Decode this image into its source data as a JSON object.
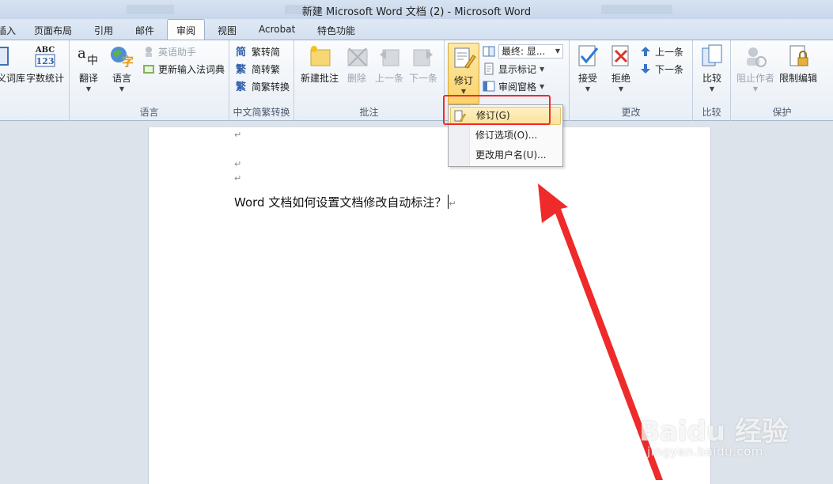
{
  "window": {
    "title": "新建 Microsoft Word 文档 (2)  -  Microsoft Word"
  },
  "tabs": [
    "插入",
    "页面布局",
    "引用",
    "邮件",
    "审阅",
    "视图",
    "Acrobat",
    "特色功能"
  ],
  "active_tab": "审阅",
  "ribbon": {
    "proofing": {
      "thesaurus_label": "义词库",
      "wordcount_label": "字数统计"
    },
    "language": {
      "group_label": "语言",
      "translate_label": "翻译",
      "language_label": "语言",
      "english_assistant_label": "英语助手",
      "update_ime_label": "更新输入法词典"
    },
    "chinese_conversion": {
      "group_label": "中文简繁转换",
      "to_simplified_label": "繁转简",
      "to_traditional_label": "简转繁",
      "convert_label": "简繁转换"
    },
    "comments": {
      "group_label": "批注",
      "new_label": "新建批注",
      "delete_label": "删除",
      "previous_label": "上一条",
      "next_label": "下一条"
    },
    "tracking": {
      "track_changes_label": "修订",
      "display_for_review_value": "最终: 显...",
      "show_markup_label": "显示标记",
      "reviewing_pane_label": "审阅窗格"
    },
    "changes": {
      "group_label": "更改",
      "accept_label": "接受",
      "reject_label": "拒绝",
      "previous_label": "上一条",
      "next_label": "下一条"
    },
    "compare": {
      "group_label": "比较",
      "compare_label": "比较"
    },
    "protect": {
      "group_label": "保护",
      "block_authors_label": "阻止作者",
      "restrict_editing_label": "限制编辑"
    }
  },
  "menu": {
    "items": [
      "修订(G)",
      "修订选项(O)...",
      "更改用户名(U)..."
    ]
  },
  "document": {
    "paragraph_mark": "↵",
    "text": "Word 文档如何设置文档修改自动标注？"
  },
  "watermark": {
    "brand": "Baidu 经验",
    "url": "jingyan.baidu.com"
  },
  "colors": {
    "annotation_red": "#ef2a2a",
    "ribbon_active": "#fbd46a"
  }
}
